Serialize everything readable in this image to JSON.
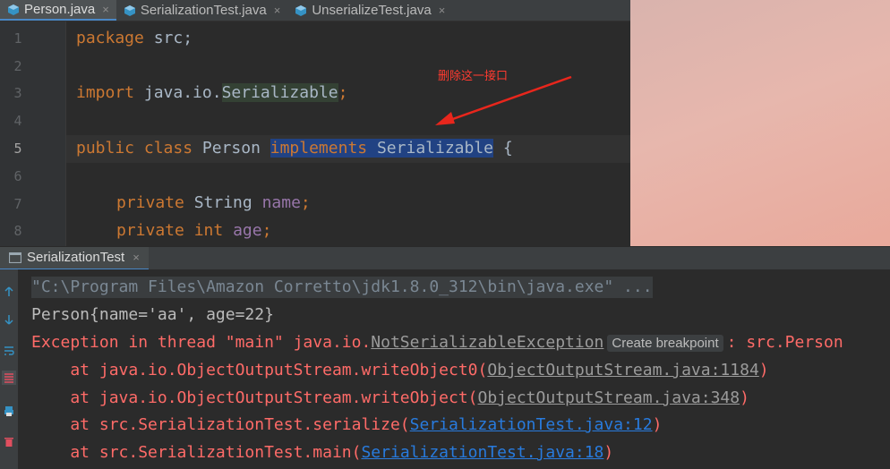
{
  "editor_tabs": [
    {
      "label": "Person.java",
      "close": "×"
    },
    {
      "label": "SerializationTest.java",
      "close": "×"
    },
    {
      "label": "UnserializeTest.java",
      "close": "×"
    }
  ],
  "gutter": {
    "lines": [
      "1",
      "2",
      "3",
      "4",
      "5",
      "6",
      "7",
      "8"
    ]
  },
  "code": {
    "line1": {
      "kw": "package",
      "rest": " src;"
    },
    "line3": {
      "kw": "import",
      "rest": " java.io.",
      "hl": "Serializable",
      "semi": ";"
    },
    "line5": {
      "kw1": "public class",
      "name": " Person ",
      "sel_kw": "implements",
      "sel_sp": " ",
      "sel_type": "Serializable",
      "rest": " {"
    },
    "line7": {
      "kw": "private",
      "type": " String ",
      "field": "name",
      "semi": ";"
    },
    "line8": {
      "kw": "private",
      "kw2": "int",
      "field": "age",
      "semi": ";"
    }
  },
  "annotation": {
    "text": "删除这一接口",
    "color": "#ff3b30"
  },
  "run_tab": {
    "label": "SerializationTest",
    "close": "×"
  },
  "console": {
    "cmd": "\"C:\\Program Files\\Amazon Corretto\\jdk1.8.0_312\\bin\\java.exe\" ...",
    "out1": "Person{name='aa', age=22}",
    "exc_prefix": "Exception in thread \"main\" java.io.",
    "exc_class": "NotSerializableException",
    "exc_breakpoint": "Create breakpoint",
    "exc_suffix": ": src.Person",
    "trace": [
      {
        "pre": "    at java.io.ObjectOutputStream.writeObject0(",
        "link": "ObjectOutputStream.java:1184",
        "post": ")"
      },
      {
        "pre": "    at java.io.ObjectOutputStream.writeObject(",
        "link": "ObjectOutputStream.java:348",
        "post": ")"
      },
      {
        "pre": "    at src.SerializationTest.serialize(",
        "link": "SerializationTest.java:12",
        "post": ")"
      },
      {
        "pre": "    at src.SerializationTest.main(",
        "link": "SerializationTest.java:18",
        "post": ")"
      }
    ]
  },
  "toolbar_icons": [
    "up-arrow-icon",
    "down-arrow-icon",
    "soft-wrap-icon",
    "scroll-to-end-icon",
    "print-icon",
    "trash-icon"
  ],
  "colors": {
    "accent": "#4a88c7",
    "error": "#ff6b68",
    "link": "#287bde"
  }
}
